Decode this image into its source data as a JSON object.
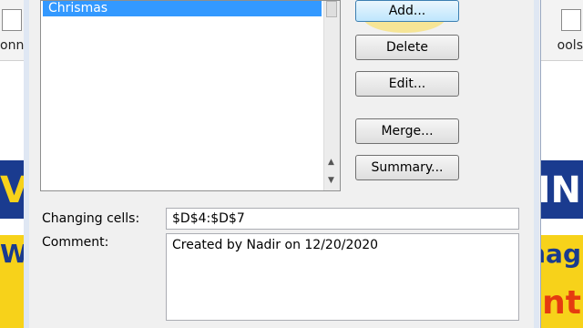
{
  "background": {
    "ribbon_left_label": "onn",
    "ribbon_right_label": "ools",
    "strip_left_top": "V",
    "strip_left_bottom": "W",
    "strip_right_top": "IIN",
    "strip_right_mid": "nag",
    "strip_right_bottom": "nt"
  },
  "dialog": {
    "scenarios": [
      "Chrismas"
    ],
    "buttons": {
      "add": "Add...",
      "delete": "Delete",
      "edit": "Edit...",
      "merge": "Merge...",
      "summary": "Summary..."
    },
    "changing_cells_label": "Changing cells:",
    "changing_cells_value": "$D$4:$D$7",
    "comment_label": "Comment:",
    "comment_value": "Created by Nadir on 12/20/2020"
  },
  "colors": {
    "selection": "#3399ff",
    "strip_blue": "#1a3b8f",
    "strip_yellow": "#f7d21a",
    "strip_red": "#e53b10"
  },
  "icons": [
    "mouse-pointer-icon",
    "scroll-up-arrow-icon",
    "scroll-down-arrow-icon"
  ]
}
